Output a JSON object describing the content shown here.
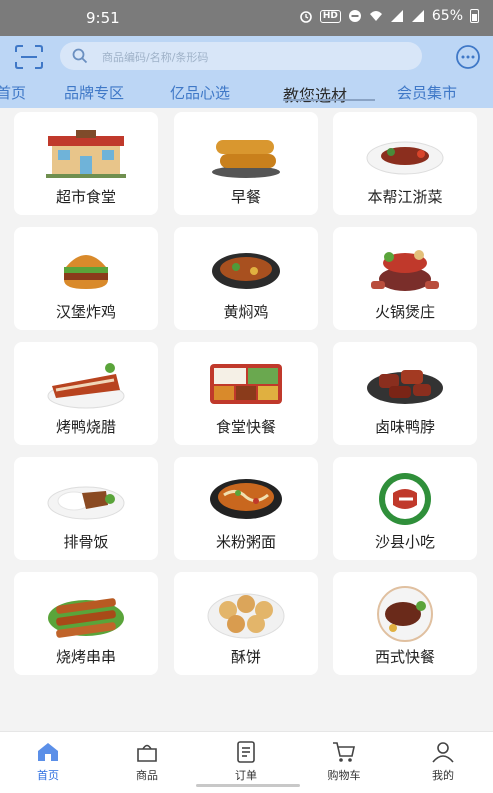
{
  "status_bar": {
    "time": "9:51",
    "network_badge": "HD",
    "battery_percent": "65%"
  },
  "header": {
    "search_placeholder": "商品编码/名称/条形码",
    "tabs": [
      {
        "label": "首页"
      },
      {
        "label": "品牌专区"
      },
      {
        "label": "亿品心选"
      },
      {
        "label": "教您选材"
      },
      {
        "label": "会员集市"
      }
    ],
    "active_tab": "教您选材"
  },
  "categories": [
    {
      "label": "超市食堂",
      "icon": "building-icon"
    },
    {
      "label": "早餐",
      "icon": "fried-dough-icon"
    },
    {
      "label": "本帮江浙菜",
      "icon": "dish-icon"
    },
    {
      "label": "汉堡炸鸡",
      "icon": "burger-icon"
    },
    {
      "label": "黄焖鸡",
      "icon": "clay-pot-icon"
    },
    {
      "label": "火锅煲庄",
      "icon": "hotpot-icon"
    },
    {
      "label": "烤鸭烧腊",
      "icon": "roast-duck-icon"
    },
    {
      "label": "食堂快餐",
      "icon": "bento-tray-icon"
    },
    {
      "label": "卤味鸭脖",
      "icon": "braised-meat-icon"
    },
    {
      "label": "排骨饭",
      "icon": "rib-rice-icon"
    },
    {
      "label": "米粉粥面",
      "icon": "noodle-bowl-icon"
    },
    {
      "label": "沙县小吃",
      "icon": "shaxian-logo-icon"
    },
    {
      "label": "烧烤串串",
      "icon": "skewer-icon"
    },
    {
      "label": "酥饼",
      "icon": "pastry-icon"
    },
    {
      "label": "西式快餐",
      "icon": "steak-plate-icon"
    }
  ],
  "bottom_nav": [
    {
      "label": "首页",
      "icon": "home-icon"
    },
    {
      "label": "商品",
      "icon": "bag-icon"
    },
    {
      "label": "订单",
      "icon": "order-icon"
    },
    {
      "label": "购物车",
      "icon": "cart-icon"
    },
    {
      "label": "我的",
      "icon": "profile-icon"
    }
  ],
  "active_nav": "首页",
  "colors": {
    "accent": "#2f6fe0",
    "header_bg": "#bcd6f5",
    "tab_text": "#3f78c7"
  }
}
